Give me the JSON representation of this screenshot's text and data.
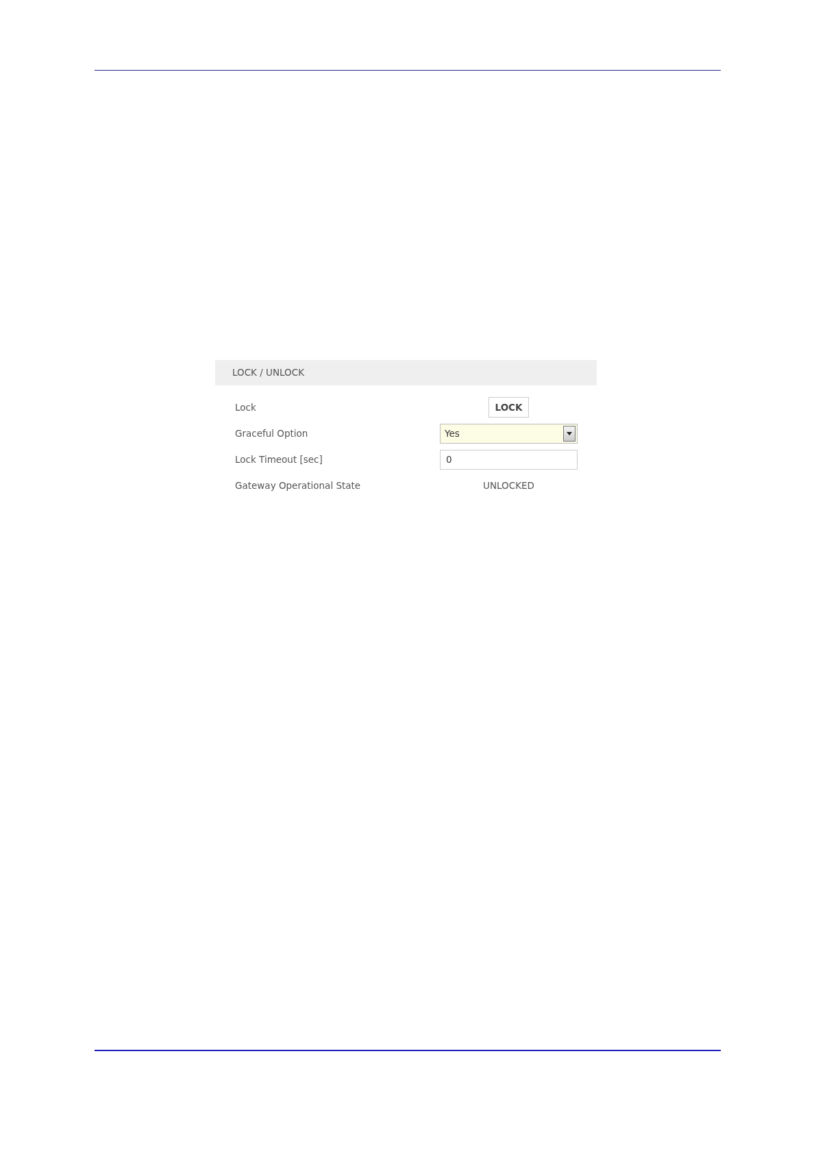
{
  "panel": {
    "title": "LOCK / UNLOCK",
    "rows": [
      {
        "kind": "button",
        "label": "Lock",
        "value": "LOCK"
      },
      {
        "kind": "select",
        "label": "Graceful Option",
        "value": "Yes"
      },
      {
        "kind": "input",
        "label": "Lock Timeout [sec]",
        "value": "0"
      },
      {
        "kind": "text",
        "label": "Gateway Operational State",
        "value": "UNLOCKED"
      }
    ]
  }
}
